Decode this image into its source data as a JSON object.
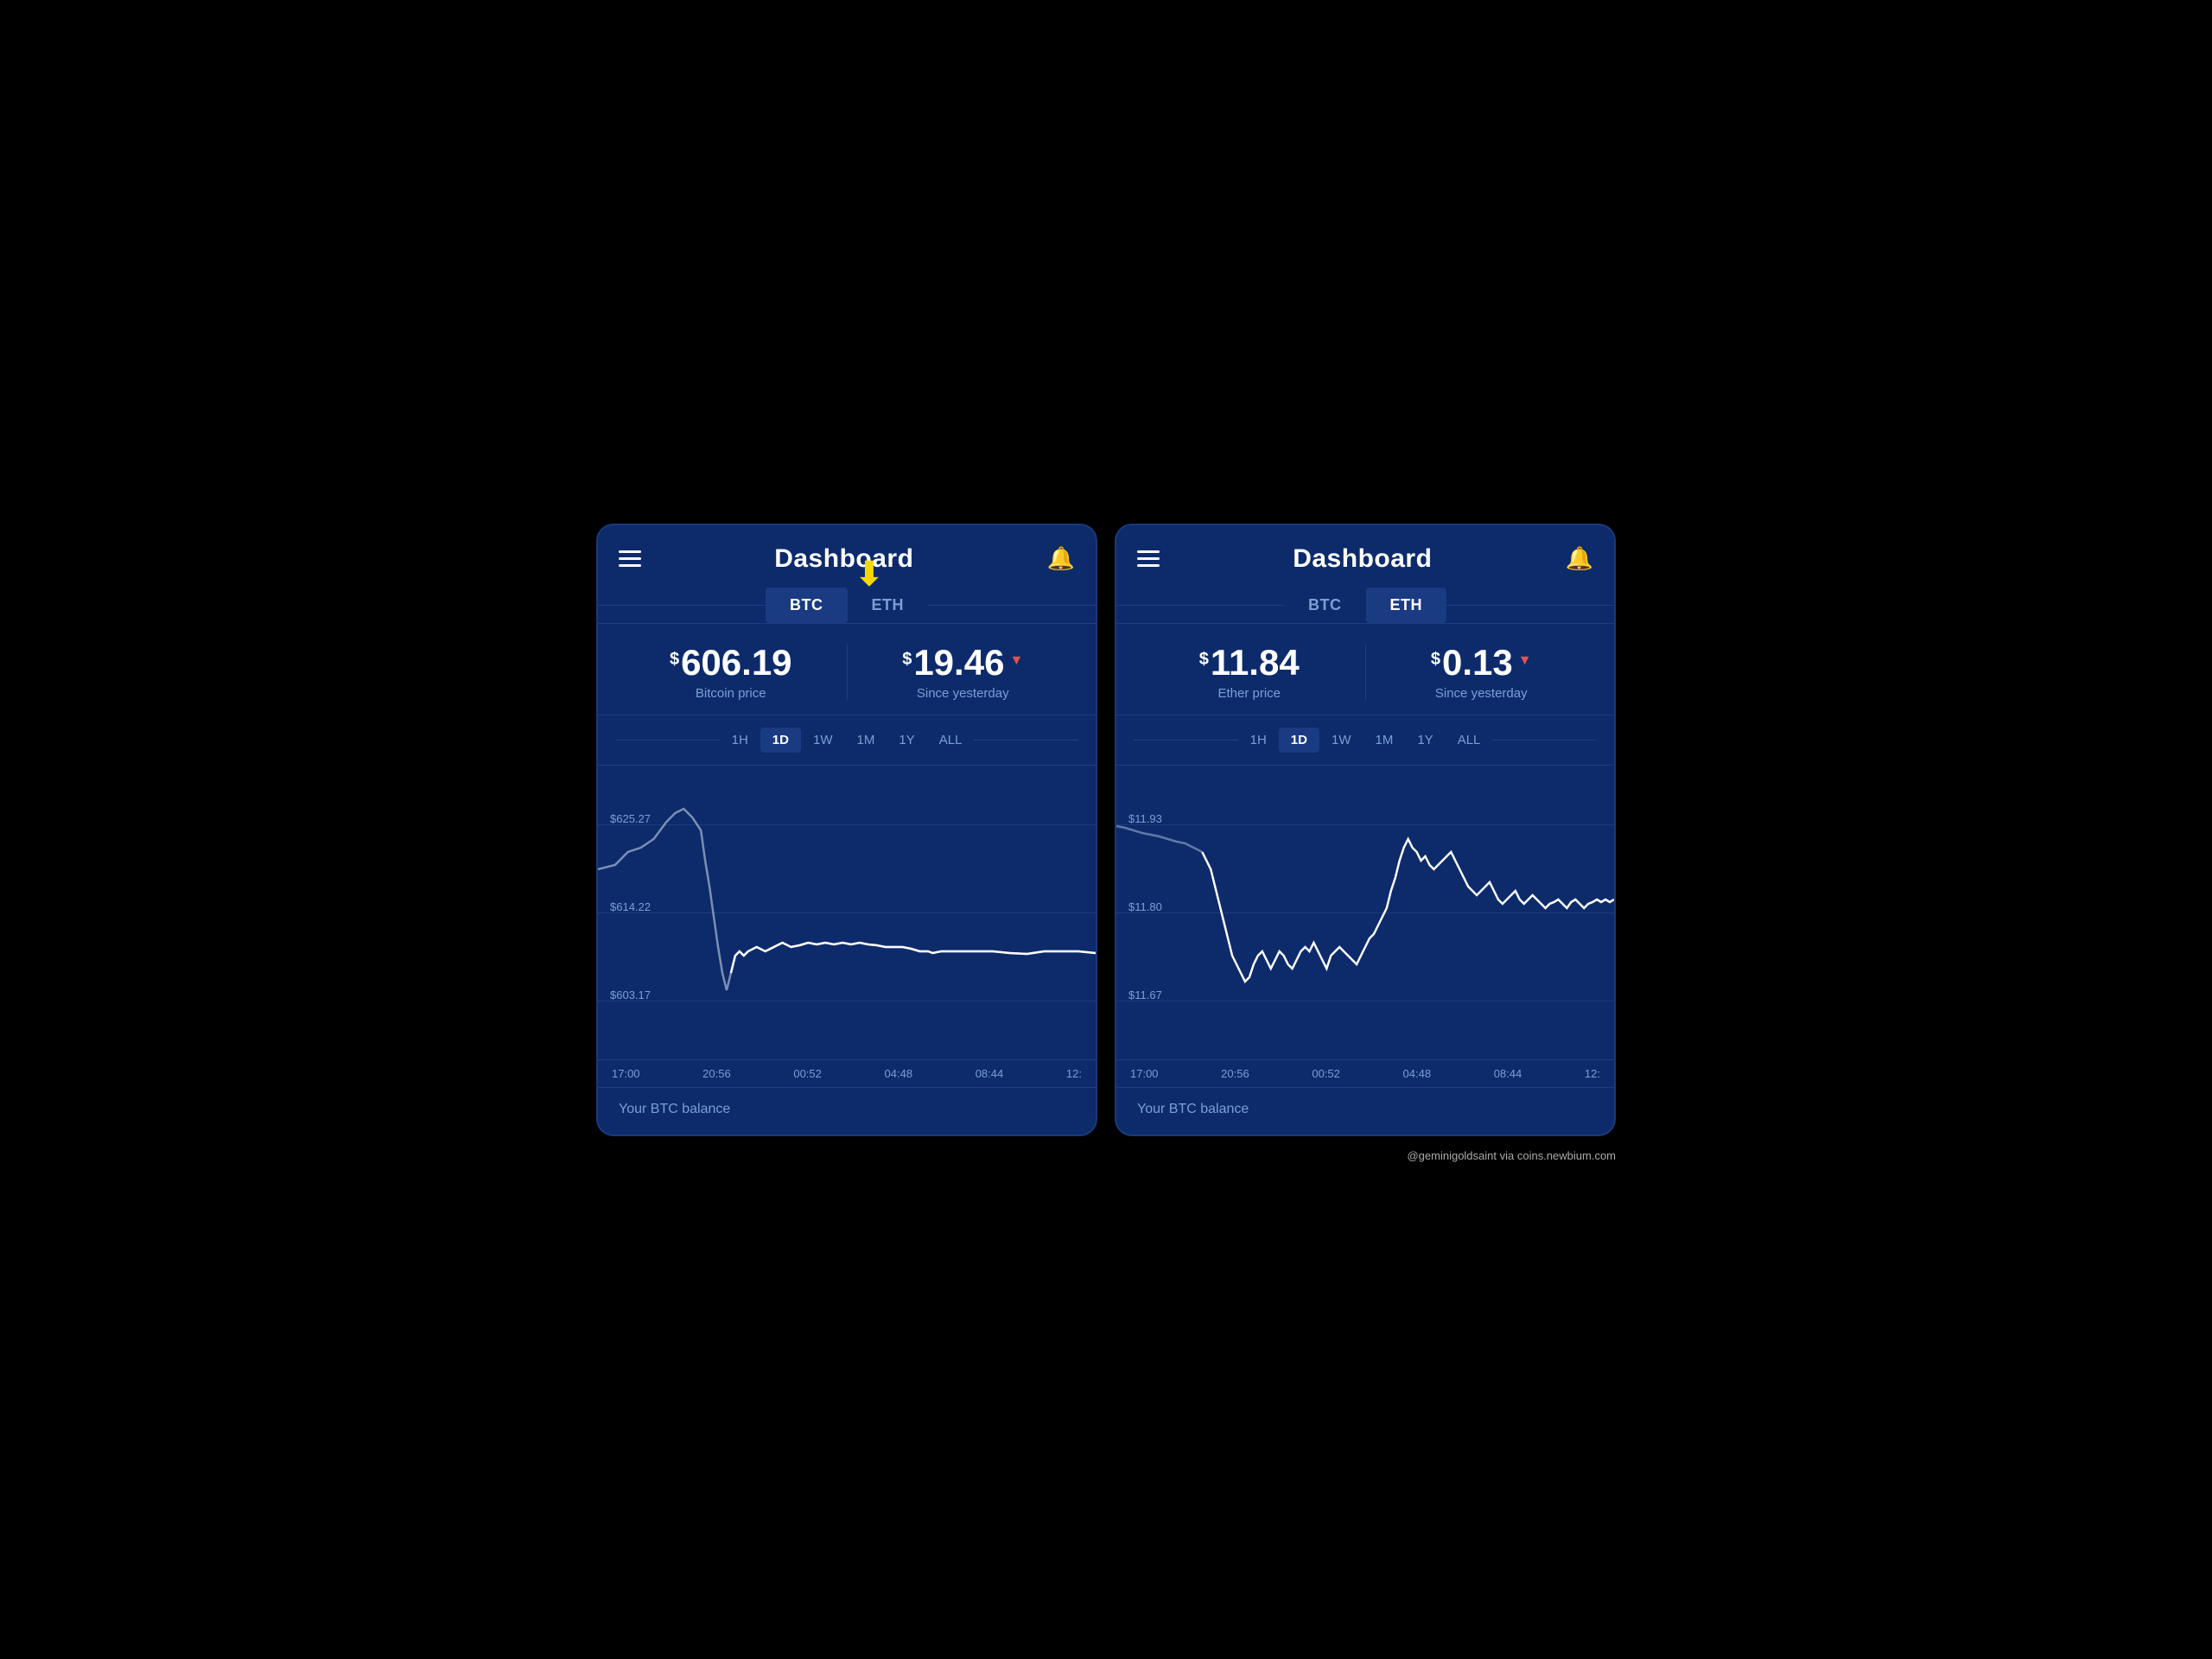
{
  "left_panel": {
    "title": "Dashboard",
    "tabs": [
      "BTC",
      "ETH"
    ],
    "active_tab": "BTC",
    "btc_price": "606.19",
    "btc_label": "Bitcoin price",
    "since_yesterday": "19.46",
    "since_label": "Since yesterday",
    "timeframes": [
      "1H",
      "1D",
      "1W",
      "1M",
      "1Y",
      "ALL"
    ],
    "active_tf": "1D",
    "chart_labels": [
      "$625.27",
      "$614.22",
      "$603.17"
    ],
    "time_labels": [
      "17:00",
      "20:56",
      "00:52",
      "04:48",
      "08:44",
      "12:"
    ],
    "footer": "Your BTC balance"
  },
  "right_panel": {
    "title": "Dashboard",
    "tabs": [
      "BTC",
      "ETH"
    ],
    "active_tab": "ETH",
    "eth_price": "11.84",
    "eth_label": "Ether price",
    "since_yesterday": "0.13",
    "since_label": "Since yesterday",
    "timeframes": [
      "1H",
      "1D",
      "1W",
      "1M",
      "1Y",
      "ALL"
    ],
    "active_tf": "1D",
    "chart_labels": [
      "$11.93",
      "$11.80",
      "$11.67"
    ],
    "time_labels": [
      "17:00",
      "20:56",
      "00:52",
      "04:48",
      "08:44",
      "12:"
    ],
    "footer": "Your BTC balance"
  },
  "watermark": "@geminigoldsaint via coins.newbium.com",
  "yellow_arrow": "⬇"
}
